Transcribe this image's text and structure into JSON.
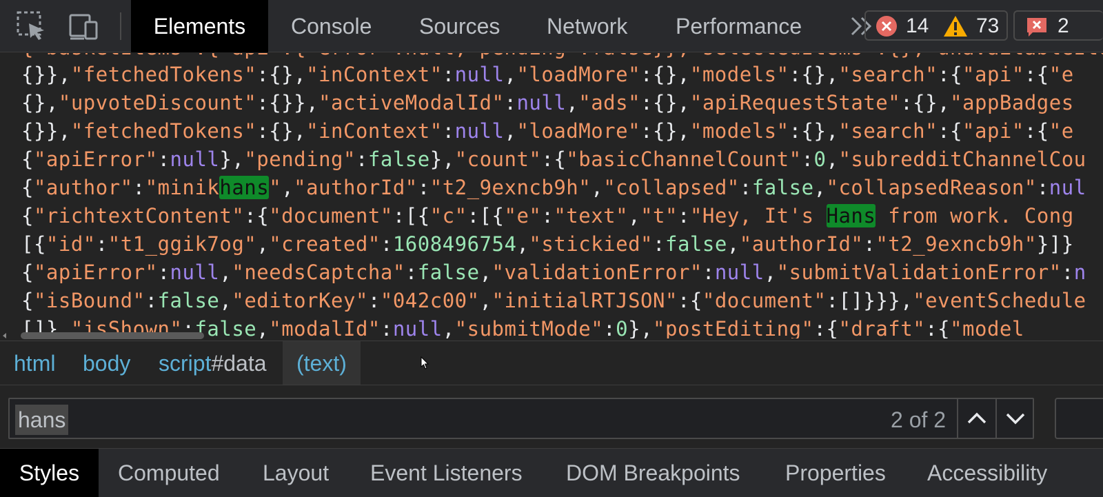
{
  "toolbar": {
    "tabs": [
      "Elements",
      "Console",
      "Sources",
      "Network",
      "Performance"
    ],
    "active_tab": "Elements",
    "errors": "14",
    "warnings": "73",
    "issues": "2",
    "icons": [
      "select-element-icon",
      "device-toolbar-icon",
      "more-tabs-icon",
      "error-icon",
      "warning-icon",
      "issues-icon"
    ]
  },
  "code": {
    "lines": [
      "{}},\"fetchedTokens\":{},\"inContext\":null,\"loadMore\":{},\"models\":{},\"search\":{\"api\":{\"e",
      "{},\"upvoteDiscount\":{}},\"activeModalId\":null,\"ads\":{},\"apiRequestState\":{},\"appBadges",
      "{}},\"fetchedTokens\":{},\"inContext\":null,\"loadMore\":{},\"models\":{},\"search\":{\"api\":{\"e",
      "{\"apiError\":null},\"pending\":false},\"count\":{\"basicChannelCount\":0,\"subredditChannelCou",
      "{\"author\":\"minikhans\",\"authorId\":\"t2_9exncb9h\",\"collapsed\":false,\"collapsedReason\":nul",
      "{\"richtextContent\":{\"document\":[{\"c\":[{\"e\":\"text\",\"t\":\"Hey, It's Hans from work. Cong",
      "[{\"id\":\"t1_ggik7og\",\"created\":1608496754,\"stickied\":false,\"authorId\":\"t2_9exncb9h\"}]}",
      "{\"apiError\":null,\"needsCaptcha\":false,\"validationError\":null,\"submitValidationError\":n",
      "{\"isBound\":false,\"editorKey\":\"042c00\",\"initialRTJSON\":{\"document\":[]}}},\"eventSchedule"
    ]
  },
  "breadcrumb": {
    "items": [
      "html",
      "body",
      "script",
      "#data",
      "(text)"
    ]
  },
  "search": {
    "query": "hans",
    "match_count": "2 of 2"
  },
  "bottom_tabs": {
    "tabs": [
      "Styles",
      "Computed",
      "Layout",
      "Event Listeners",
      "DOM Breakpoints",
      "Properties",
      "Accessibility"
    ],
    "active_tab": "Styles"
  },
  "colors": {
    "key": "#f29766",
    "null": "#9e84ec",
    "boolean": "#9ae6b4",
    "highlight": "#0f8a2a",
    "link": "#5db0d7",
    "error": "#e46962",
    "warning": "#f9ab00"
  }
}
